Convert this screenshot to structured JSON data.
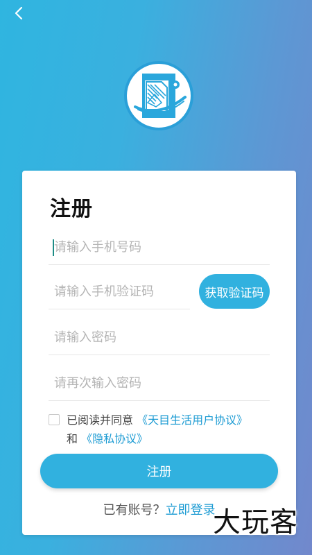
{
  "colors": {
    "accent": "#31b1df",
    "link": "#1c9bd3",
    "background_start": "#2fb5e0",
    "background_end": "#7288cc"
  },
  "header": {
    "back_icon": "chevron-left-icon"
  },
  "logo": {
    "icon": "app-logo"
  },
  "form": {
    "title": "注册",
    "phone_placeholder": "请输入手机号码",
    "code_placeholder": "请输入手机验证码",
    "get_code_label": "获取验证码",
    "password_placeholder": "请输入密码",
    "confirm_password_placeholder": "请再次输入密码",
    "agree_prefix": "已阅读并同意",
    "user_agreement": "《天目生活用户协议》",
    "and_text": "和",
    "privacy_agreement": "《隐私协议》",
    "register_label": "注册",
    "has_account_text": "已有账号？",
    "login_link": "立即登录"
  },
  "watermark": "大玩客"
}
